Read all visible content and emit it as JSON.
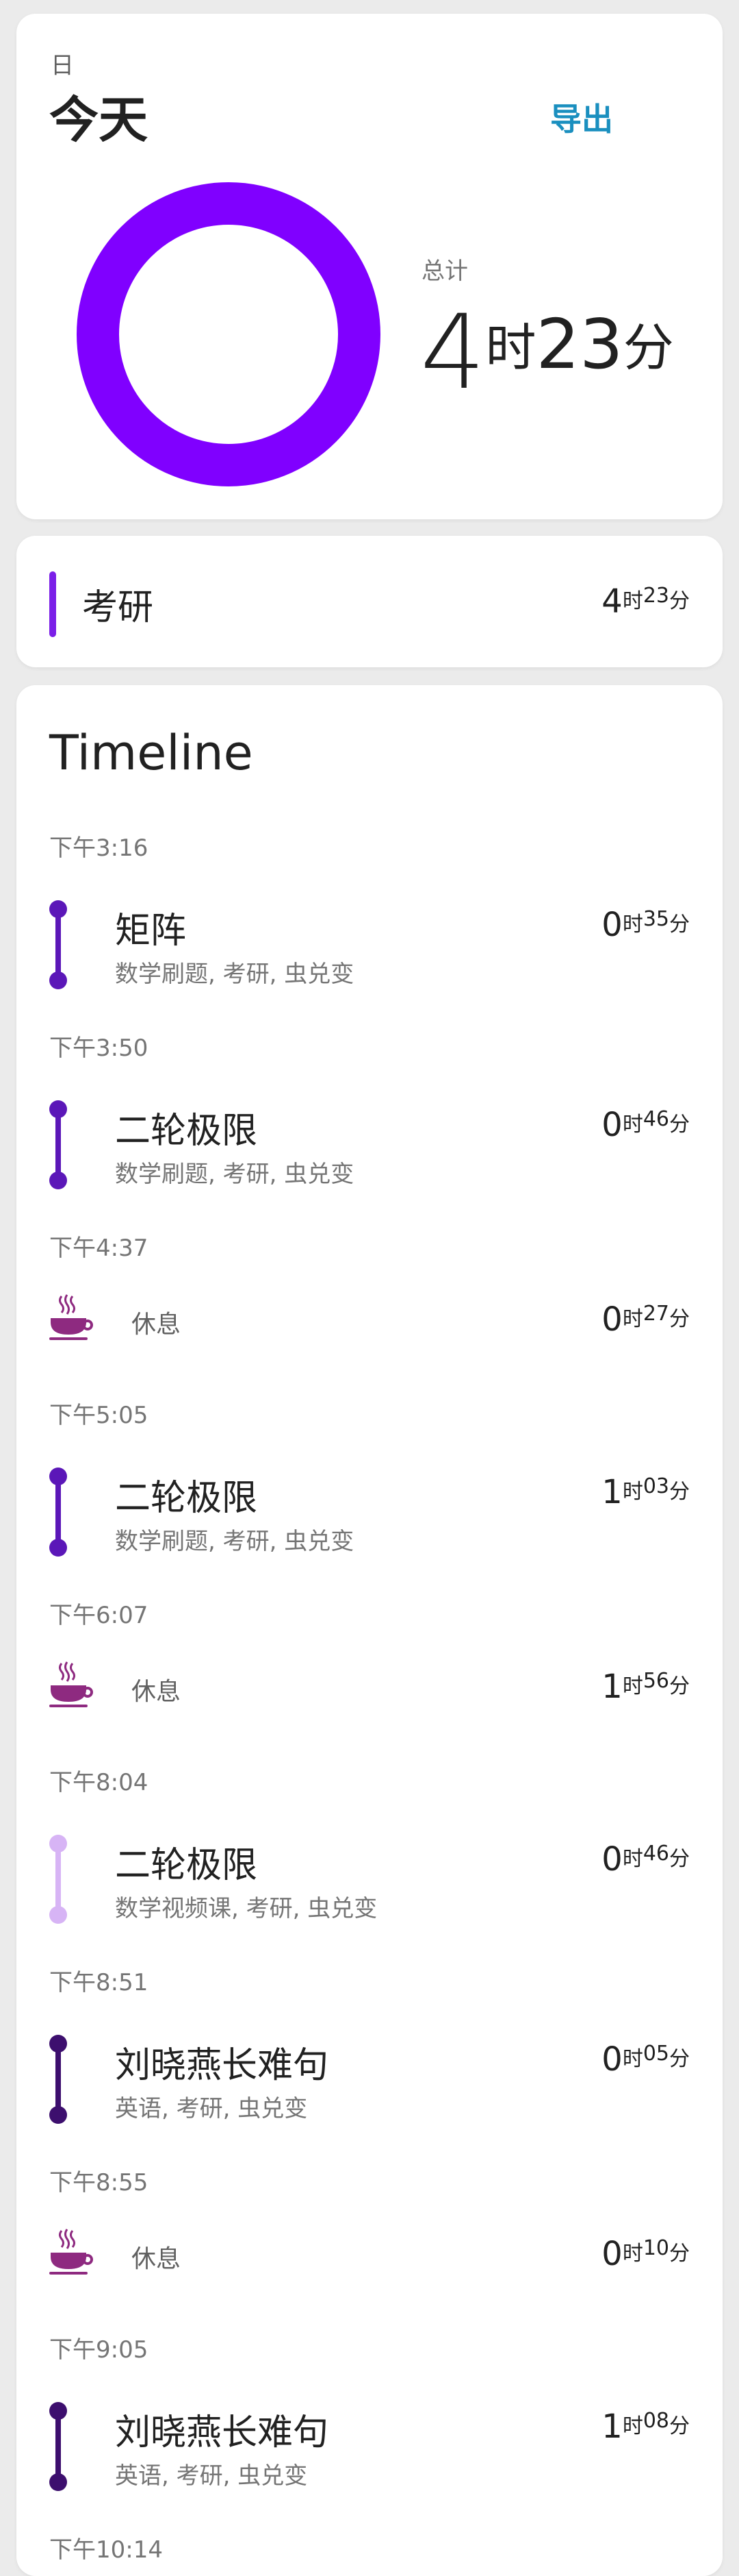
{
  "header": {
    "period": "日",
    "title": "今天",
    "export_label": "导出"
  },
  "summary": {
    "total_label": "总计",
    "hours": "4",
    "hour_unit": "时",
    "minutes": "23",
    "minute_unit": "分",
    "ring_color": "#8000ff",
    "ring_fraction": 1.0
  },
  "categories": [
    {
      "name": "考研",
      "hours": "4",
      "minutes": "23",
      "color": "#7b1fe8"
    }
  ],
  "timeline": {
    "title": "Timeline",
    "entries": [
      {
        "time": "下午3:16",
        "kind": "session",
        "name": "矩阵",
        "tags": "数学刷题, 考研, 虫兑变",
        "hours": "0",
        "minutes": "35",
        "color": "#5b17b8"
      },
      {
        "time": "下午3:50",
        "kind": "session",
        "name": "二轮极限",
        "tags": "数学刷题, 考研, 虫兑变",
        "hours": "0",
        "minutes": "46",
        "color": "#5b17b8"
      },
      {
        "time": "下午4:37",
        "kind": "break",
        "name": "休息",
        "hours": "0",
        "minutes": "27",
        "color": "#8e2a80"
      },
      {
        "time": "下午5:05",
        "kind": "session",
        "name": "二轮极限",
        "tags": "数学刷题, 考研, 虫兑变",
        "hours": "1",
        "minutes": "03",
        "color": "#5b17b8"
      },
      {
        "time": "下午6:07",
        "kind": "break",
        "name": "休息",
        "hours": "1",
        "minutes": "56",
        "color": "#8e2a80"
      },
      {
        "time": "下午8:04",
        "kind": "session",
        "name": "二轮极限",
        "tags": "数学视频课, 考研, 虫兑变",
        "hours": "0",
        "minutes": "46",
        "color": "#d7b4f5"
      },
      {
        "time": "下午8:51",
        "kind": "session",
        "name": "刘晓燕长难句",
        "tags": "英语, 考研, 虫兑变",
        "hours": "0",
        "minutes": "05",
        "color": "#3d0f6e"
      },
      {
        "time": "下午8:55",
        "kind": "break",
        "name": "休息",
        "hours": "0",
        "minutes": "10",
        "color": "#8e2a80"
      },
      {
        "time": "下午9:05",
        "kind": "session",
        "name": "刘晓燕长难句",
        "tags": "英语, 考研, 虫兑变",
        "hours": "1",
        "minutes": "08",
        "color": "#3d0f6e"
      },
      {
        "time": "下午10:14",
        "kind": "time-only"
      }
    ]
  }
}
